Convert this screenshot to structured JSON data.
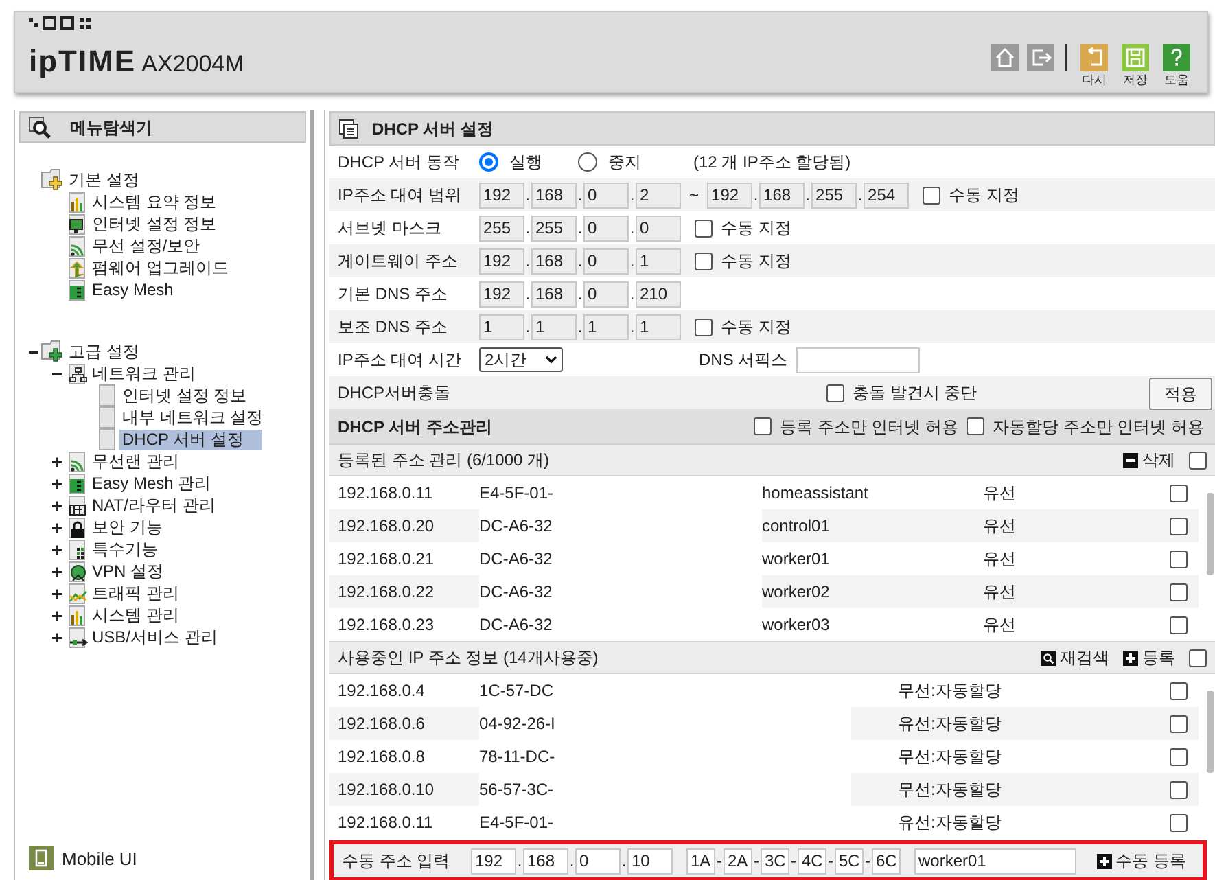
{
  "header": {
    "brand": "ipTIME",
    "model": "AX2004M",
    "buttons": [
      {
        "kind": "undo",
        "label": "다시"
      },
      {
        "kind": "save",
        "label": "저장"
      },
      {
        "kind": "help",
        "label": "도움"
      }
    ]
  },
  "sidebar": {
    "title": "메뉴탐색기",
    "tree": [
      {
        "label": "기본 설정",
        "kind": "basic",
        "selected": false,
        "children": [
          {
            "label": "시스템 요약 정보",
            "kind": "chart",
            "selected": false
          },
          {
            "label": "인터넷 설정 정보",
            "kind": "monitor",
            "selected": false
          },
          {
            "label": "무선 설정/보안",
            "kind": "wifi",
            "selected": false
          },
          {
            "label": "펌웨어 업그레이드",
            "kind": "upgrade",
            "selected": false
          },
          {
            "label": "Easy Mesh",
            "kind": "mesh",
            "selected": false
          }
        ]
      },
      {
        "label": "고급 설정",
        "kind": "advanced",
        "expanded": true,
        "selected": false,
        "children": [
          {
            "label": "네트워크 관리",
            "kind": "network",
            "expanded": true,
            "selected": false,
            "children": [
              {
                "label": "인터넷 설정 정보",
                "kind": "page",
                "selected": false
              },
              {
                "label": "내부 네트워크 설정",
                "kind": "page",
                "selected": false
              },
              {
                "label": "DHCP 서버 설정",
                "kind": "page",
                "selected": true
              }
            ]
          },
          {
            "label": "무선랜 관리",
            "kind": "wifi",
            "expanded": false,
            "selected": false
          },
          {
            "label": "Easy Mesh 관리",
            "kind": "mesh",
            "expanded": false,
            "selected": false
          },
          {
            "label": "NAT/라우터 관리",
            "kind": "nat",
            "expanded": false,
            "selected": false
          },
          {
            "label": "보안 기능",
            "kind": "lock",
            "expanded": false,
            "selected": false
          },
          {
            "label": "특수기능",
            "kind": "special",
            "expanded": false,
            "selected": false
          },
          {
            "label": "VPN 설정",
            "kind": "vpn",
            "expanded": false,
            "selected": false
          },
          {
            "label": "트래픽 관리",
            "kind": "traffic",
            "expanded": false,
            "selected": false
          },
          {
            "label": "시스템 관리",
            "kind": "chart",
            "expanded": false,
            "selected": false
          },
          {
            "label": "USB/서비스 관리",
            "kind": "usb",
            "expanded": false,
            "selected": false
          }
        ]
      }
    ],
    "mobile": "Mobile UI"
  },
  "main": {
    "title": "DHCP 서버 설정",
    "octet_separator": ".",
    "mac_separator": "-",
    "operation": {
      "label": "DHCP 서버 동작",
      "options": [
        {
          "label": "실행",
          "selected": true
        },
        {
          "label": "중지",
          "selected": false
        }
      ],
      "note": "(12 개 IP주소 할당됨)"
    },
    "range": {
      "label": "IP주소 대여 범위",
      "start": [
        "192",
        "168",
        "0",
        "2"
      ],
      "separator": "~",
      "end": [
        "192",
        "168",
        "255",
        "254"
      ],
      "manual": {
        "label": "수동 지정",
        "checked": false
      }
    },
    "ip_rows": [
      {
        "label": "서브넷 마스크",
        "octets": [
          "255",
          "255",
          "0",
          "0"
        ],
        "manual": {
          "label": "수동 지정",
          "checked": false
        }
      },
      {
        "label": "게이트웨이 주소",
        "octets": [
          "192",
          "168",
          "0",
          "1"
        ],
        "manual": {
          "label": "수동 지정",
          "checked": false
        }
      },
      {
        "label": "기본 DNS 주소",
        "octets": [
          "192",
          "168",
          "0",
          "210"
        ]
      },
      {
        "label": "보조 DNS 주소",
        "octets": [
          "1",
          "1",
          "1",
          "1"
        ],
        "manual": {
          "label": "수동 지정",
          "checked": false
        }
      }
    ],
    "lease": {
      "label": "IP주소 대여 시간",
      "value": "2시간",
      "suffix_label": "DNS 서픽스"
    },
    "conflict": {
      "label": "DHCP서버충돌",
      "option": {
        "label": "충돌 발견시 중단",
        "checked": false
      },
      "button": "적용"
    },
    "address_section": {
      "title": "DHCP 서버 주소관리",
      "options": [
        {
          "label": "등록 주소만 인터넷 허용",
          "checked": false
        },
        {
          "label": "자동할당 주소만 인터넷 허용",
          "checked": false
        }
      ]
    },
    "registered": {
      "title": "등록된 주소 관리 (6/1000 개)",
      "actions": [
        {
          "kind": "delete",
          "label": "삭제"
        }
      ],
      "all_checked": false,
      "rows": [
        {
          "ip": "192.168.0.11",
          "mac": "E4-5F-01-",
          "name": "homeassistant",
          "type": "유선",
          "checked": false
        },
        {
          "ip": "192.168.0.20",
          "mac": "DC-A6-32",
          "name": "control01",
          "type": "유선",
          "checked": false
        },
        {
          "ip": "192.168.0.21",
          "mac": "DC-A6-32",
          "name": "worker01",
          "type": "유선",
          "checked": false
        },
        {
          "ip": "192.168.0.22",
          "mac": "DC-A6-32",
          "name": "worker02",
          "type": "유선",
          "checked": false
        },
        {
          "ip": "192.168.0.23",
          "mac": "DC-A6-32",
          "name": "worker03",
          "type": "유선",
          "checked": false
        }
      ]
    },
    "in_use": {
      "title": "사용중인 IP 주소 정보 (14개사용중)",
      "actions": [
        {
          "kind": "rescan",
          "label": "재검색"
        },
        {
          "kind": "add",
          "label": "등록"
        }
      ],
      "all_checked": false,
      "rows": [
        {
          "ip": "192.168.0.4",
          "mac": "1C-57-DC",
          "type": "무선:자동할당",
          "checked": false
        },
        {
          "ip": "192.168.0.6",
          "mac": "04-92-26-I",
          "type": "유선:자동할당",
          "checked": false
        },
        {
          "ip": "192.168.0.8",
          "mac": "78-11-DC-",
          "type": "무선:자동할당",
          "checked": false
        },
        {
          "ip": "192.168.0.10",
          "mac": "56-57-3C-",
          "type": "무선:자동할당",
          "checked": false
        },
        {
          "ip": "192.168.0.11",
          "mac": "E4-5F-01-",
          "type": "유선:자동할당",
          "checked": false
        }
      ]
    },
    "manual_entry": {
      "label": "수동 주소 입력",
      "octets": [
        "192",
        "168",
        "0",
        "10"
      ],
      "mac": [
        "1A",
        "2A",
        "3C",
        "4C",
        "5C",
        "6C"
      ],
      "name": "worker01",
      "button": "수동 등록"
    }
  }
}
